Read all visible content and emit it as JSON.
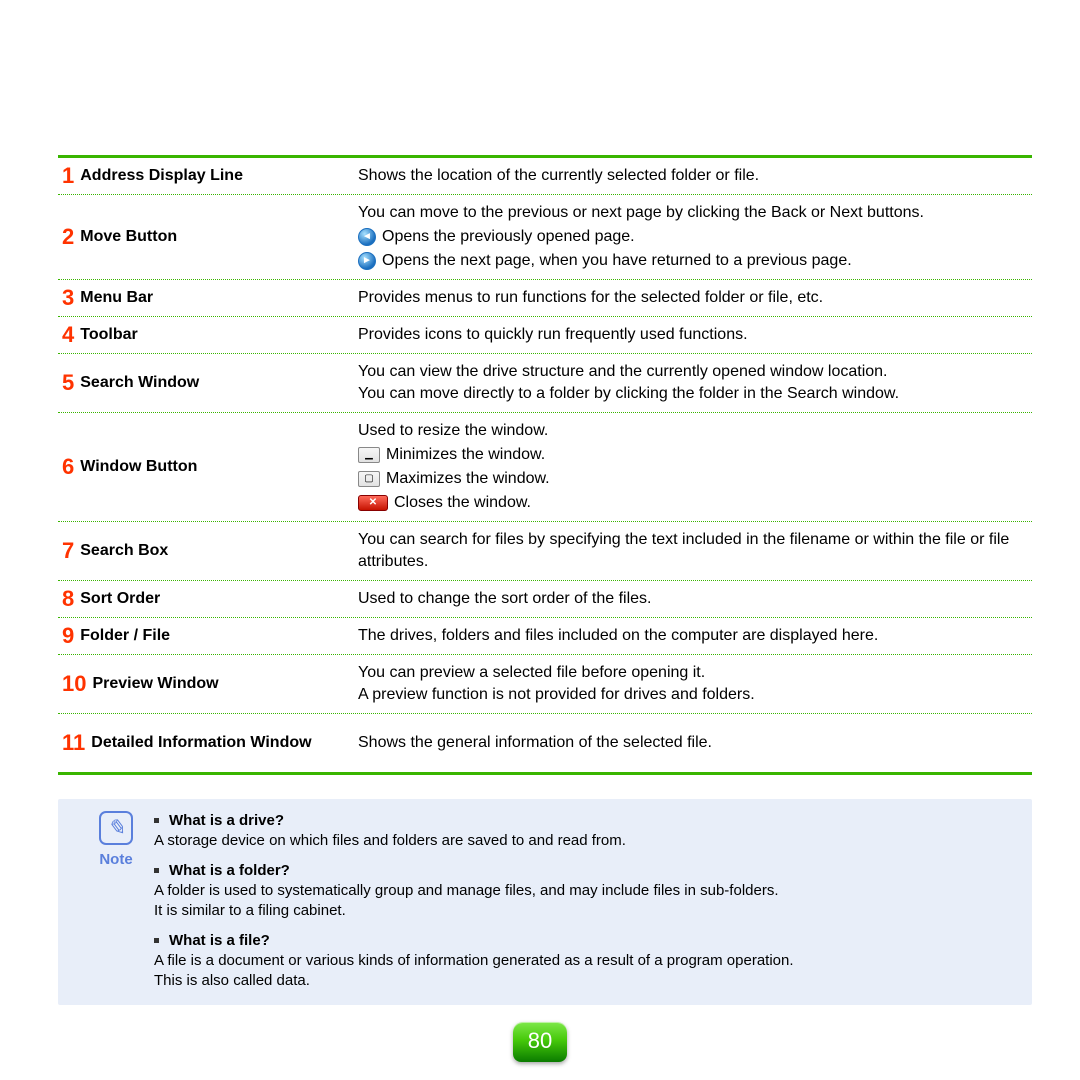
{
  "page_number": "80",
  "rows": [
    {
      "num": "1",
      "label": "Address Display Line",
      "desc": "Shows the location of the currently selected folder or file."
    },
    {
      "num": "2",
      "label": "Move Button",
      "desc": "You can move to the previous or next page by clicking the Back or Next buttons.",
      "back_desc": "Opens the previously opened page.",
      "next_desc": "Opens the next page, when you have returned to a previous page."
    },
    {
      "num": "3",
      "label": "Menu Bar",
      "desc": "Provides menus to run functions for the selected folder or file, etc."
    },
    {
      "num": "4",
      "label": "Toolbar",
      "desc": "Provides icons to quickly run frequently used functions."
    },
    {
      "num": "5",
      "label": "Search Window",
      "desc_line1": "You can view the drive structure and the currently opened window location.",
      "desc_line2": "You can move directly to a folder by clicking the folder in the Search window."
    },
    {
      "num": "6",
      "label": "Window Button",
      "intro": "Used to resize the window.",
      "min_desc": "Minimizes the window.",
      "max_desc": "Maximizes the window.",
      "close_desc": "Closes the window."
    },
    {
      "num": "7",
      "label": "Search Box",
      "desc": "You can search for files by specifying the text included in the filename or within the file or file attributes."
    },
    {
      "num": "8",
      "label": "Sort Order",
      "desc": "Used to change the sort order of the files."
    },
    {
      "num": "9",
      "label": "Folder / File",
      "desc": "The drives, folders and files included on the computer are displayed here."
    },
    {
      "num": "10",
      "label": "Preview Window",
      "desc_line1": "You can preview a selected file before opening it.",
      "desc_line2": "A preview function is not provided for drives and folders."
    },
    {
      "num": "11",
      "label": "Detailed Information Window",
      "desc": "Shows the general information of the selected file."
    }
  ],
  "note": {
    "label": "Note",
    "items": [
      {
        "q": "What is a drive?",
        "a": "A storage device on which files and folders are saved to and read from."
      },
      {
        "q": "What is a folder?",
        "a1": "A folder is used to systematically group and manage files, and may include files in sub-folders.",
        "a2": "It is similar to a filing cabinet."
      },
      {
        "q": "What is a file?",
        "a1": "A file is a document or various kinds of information generated as a result of a program operation.",
        "a2": "This is also called data."
      }
    ]
  }
}
